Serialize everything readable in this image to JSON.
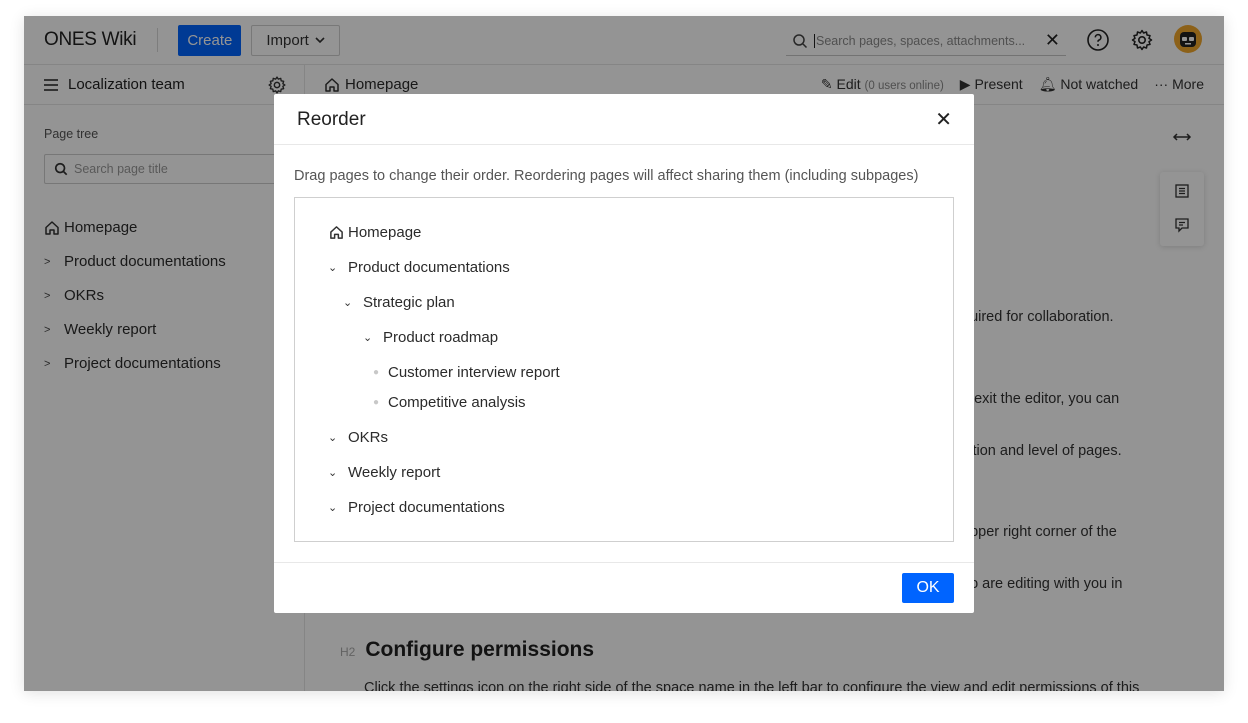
{
  "topbar": {
    "app_name": "ONES Wiki",
    "create_label": "Create",
    "import_label": "Import",
    "search_placeholder": "Search pages, spaces, attachments..."
  },
  "sidebar": {
    "space_name": "Localization team",
    "page_tree_label": "Page tree",
    "search_placeholder": "Search page title",
    "items": [
      {
        "label": "Homepage"
      },
      {
        "label": "Product documentations"
      },
      {
        "label": "OKRs"
      },
      {
        "label": "Weekly report"
      },
      {
        "label": "Project documentations"
      }
    ]
  },
  "content": {
    "breadcrumb": "Homepage",
    "edit_label": "Edit",
    "users_online": "(0 users online)",
    "present_label": "Present",
    "watch_label": "Not watched",
    "more_label": "More",
    "snippets": [
      "quired for collaboration.",
      "u exit the editor, you can",
      "sition and level of pages.",
      "upper right corner of the",
      "no are editing with you in"
    ],
    "h2_tag": "H2",
    "h2": "Configure permissions",
    "para": "Click the settings icon on the right side of the space name in the left bar to configure the view and edit permissions of this"
  },
  "modal": {
    "title": "Reorder",
    "description": "Drag pages to change their order. Reordering pages will affect sharing them (including subpages)",
    "tree": [
      {
        "label": "Homepage"
      },
      {
        "label": "Product documentations"
      },
      {
        "label": "Strategic plan"
      },
      {
        "label": "Product roadmap"
      },
      {
        "label": "Customer interview report"
      },
      {
        "label": "Competitive analysis"
      },
      {
        "label": "OKRs"
      },
      {
        "label": "Weekly report"
      },
      {
        "label": "Project documentations"
      }
    ],
    "ok_label": "OK"
  },
  "colors": {
    "primary": "#0064ff",
    "overlay": "rgba(0,0,0,0.42)"
  }
}
